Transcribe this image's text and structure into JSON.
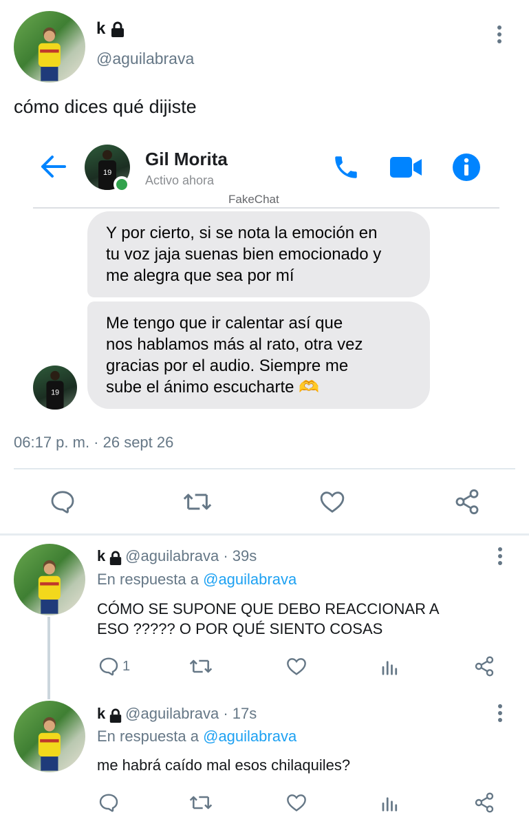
{
  "main_tweet": {
    "name": "k",
    "handle": "@aguilabrava",
    "text": "cómo dices qué dijiste",
    "time": "06:17 p. m. · 26 sept 26"
  },
  "chat": {
    "contact_name": "Gil Morita",
    "status": "Activo ahora",
    "watermark": "FakeChat",
    "messages": [
      "Y por cierto, si se nota la emoción en tu voz jaja suenas bien emocionado y me alegra que sea por mí",
      "Me tengo que ir calentar así que nos hablamos más al rato, otra vez gracias por el audio. Siempre me sube el ánimo escucharte 🫶"
    ],
    "messages_lines": [
      [
        "Y por cierto, si se nota la emoción en",
        "tu voz jaja suenas bien emocionado y",
        "me alegra que sea por mí"
      ],
      [
        "Me tengo que ir calentar así que",
        "nos hablamos más al rato, otra vez",
        "gracias por el audio. Siempre me",
        "sube el ánimo escucharte 🫶"
      ]
    ],
    "accent": "#0084ff",
    "online": "#31a24c"
  },
  "replies": [
    {
      "name": "k",
      "handle": "@aguilabrava · 39s",
      "reply_prefix": "En respuesta a",
      "reply_to": "@aguilabrava",
      "text_lines": [
        "CÓMO SE SUPONE QUE DEBO REACCIONAR A",
        "ESO ????? O POR QUÉ SIENTO COSAS"
      ],
      "reply_count": "1"
    },
    {
      "name": "k",
      "handle": "@aguilabrava · 17s",
      "reply_prefix": "En respuesta a",
      "reply_to": "@aguilabrava",
      "text_lines": [
        "me habrá caído mal esos chilaquiles?"
      ],
      "reply_count": ""
    }
  ],
  "icons": {
    "back": "arrow-left-icon",
    "call": "phone-icon",
    "video": "video-camera-icon",
    "info": "info-icon",
    "reply": "reply-icon",
    "retweet": "retweet-icon",
    "like": "heart-icon",
    "share": "share-icon",
    "analytics": "analytics-icon",
    "more": "more-vertical-icon",
    "lock": "lock-icon"
  },
  "colors": {
    "twitter_blue": "#1da1f2",
    "gray": "#657786",
    "bubble": "#e9e9eb"
  }
}
